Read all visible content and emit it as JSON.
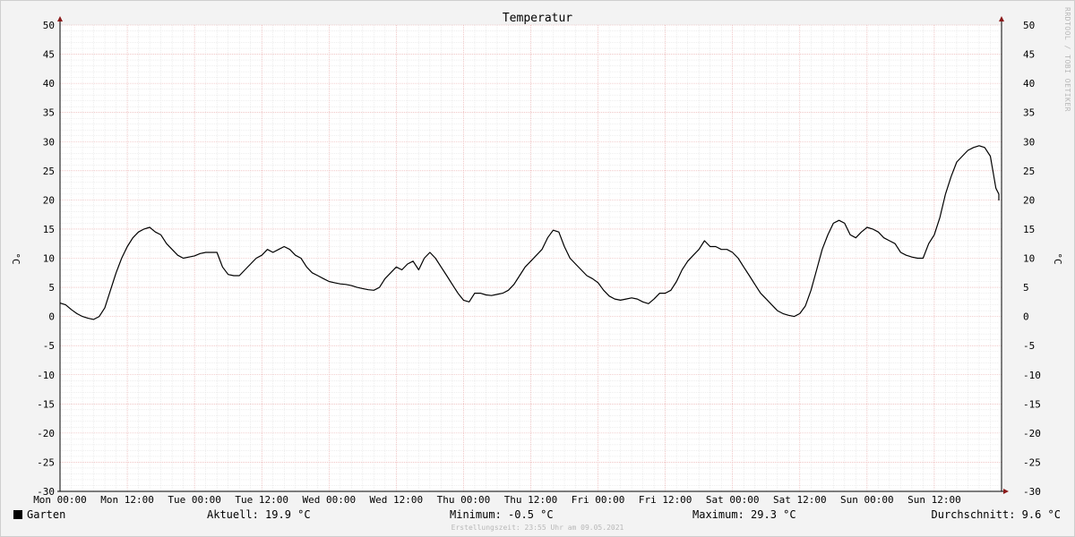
{
  "chart_data": {
    "type": "line",
    "title": "Temperatur",
    "ylabel_left": "°C",
    "ylabel_right": "°C",
    "ylim": [
      -30,
      50
    ],
    "y_ticks": [
      50,
      45,
      40,
      35,
      30,
      25,
      20,
      15,
      10,
      5,
      0,
      -5,
      -10,
      -15,
      -20,
      -25,
      -30
    ],
    "x_ticks": [
      "Mon 00:00",
      "Mon 12:00",
      "Tue 00:00",
      "Tue 12:00",
      "Wed 00:00",
      "Wed 12:00",
      "Thu 00:00",
      "Thu 12:00",
      "Fri 00:00",
      "Fri 12:00",
      "Sat 00:00",
      "Sat 12:00",
      "Sun 00:00",
      "Sun 12:00"
    ],
    "x_unit": "hours since Mon 00:00",
    "xlim": [
      0,
      168
    ],
    "grid": true,
    "series": [
      {
        "name": "Garten",
        "color": "#000000",
        "points": [
          [
            0,
            2.3
          ],
          [
            1,
            2.0
          ],
          [
            2,
            1.2
          ],
          [
            3,
            0.5
          ],
          [
            4,
            0.0
          ],
          [
            5,
            -0.3
          ],
          [
            6,
            -0.5
          ],
          [
            7,
            0.0
          ],
          [
            8,
            1.5
          ],
          [
            9,
            4.5
          ],
          [
            10,
            7.5
          ],
          [
            11,
            10.0
          ],
          [
            12,
            12.0
          ],
          [
            13,
            13.5
          ],
          [
            14,
            14.5
          ],
          [
            15,
            15.0
          ],
          [
            16,
            15.3
          ],
          [
            17,
            14.5
          ],
          [
            18,
            14.0
          ],
          [
            19,
            12.5
          ],
          [
            20,
            11.5
          ],
          [
            21,
            10.5
          ],
          [
            22,
            10.0
          ],
          [
            23,
            10.2
          ],
          [
            24,
            10.4
          ],
          [
            25,
            10.8
          ],
          [
            26,
            11.0
          ],
          [
            27,
            11.0
          ],
          [
            28,
            11.0
          ],
          [
            29,
            8.5
          ],
          [
            30,
            7.2
          ],
          [
            31,
            7.0
          ],
          [
            32,
            7.0
          ],
          [
            33,
            8.0
          ],
          [
            34,
            9.0
          ],
          [
            35,
            10.0
          ],
          [
            36,
            10.5
          ],
          [
            37,
            11.5
          ],
          [
            38,
            11.0
          ],
          [
            39,
            11.5
          ],
          [
            40,
            12.0
          ],
          [
            41,
            11.5
          ],
          [
            42,
            10.5
          ],
          [
            43,
            10.0
          ],
          [
            44,
            8.5
          ],
          [
            45,
            7.5
          ],
          [
            46,
            7.0
          ],
          [
            47,
            6.5
          ],
          [
            48,
            6.0
          ],
          [
            49,
            5.8
          ],
          [
            50,
            5.6
          ],
          [
            51,
            5.5
          ],
          [
            52,
            5.3
          ],
          [
            53,
            5.0
          ],
          [
            54,
            4.8
          ],
          [
            55,
            4.6
          ],
          [
            56,
            4.5
          ],
          [
            57,
            5.0
          ],
          [
            58,
            6.5
          ],
          [
            59,
            7.5
          ],
          [
            60,
            8.5
          ],
          [
            61,
            8.0
          ],
          [
            62,
            9.0
          ],
          [
            63,
            9.5
          ],
          [
            64,
            8.0
          ],
          [
            65,
            10.0
          ],
          [
            66,
            11.0
          ],
          [
            67,
            10.0
          ],
          [
            68,
            8.5
          ],
          [
            69,
            7.0
          ],
          [
            70,
            5.5
          ],
          [
            71,
            4.0
          ],
          [
            72,
            2.8
          ],
          [
            73,
            2.5
          ],
          [
            74,
            4.0
          ],
          [
            75,
            4.0
          ],
          [
            76,
            3.7
          ],
          [
            77,
            3.6
          ],
          [
            78,
            3.8
          ],
          [
            79,
            4.0
          ],
          [
            80,
            4.5
          ],
          [
            81,
            5.5
          ],
          [
            82,
            7.0
          ],
          [
            83,
            8.5
          ],
          [
            84,
            9.5
          ],
          [
            85,
            10.5
          ],
          [
            86,
            11.5
          ],
          [
            87,
            13.5
          ],
          [
            88,
            14.8
          ],
          [
            89,
            14.5
          ],
          [
            90,
            12.0
          ],
          [
            91,
            10.0
          ],
          [
            92,
            9.0
          ],
          [
            93,
            8.0
          ],
          [
            94,
            7.0
          ],
          [
            95,
            6.5
          ],
          [
            96,
            5.8
          ],
          [
            97,
            4.5
          ],
          [
            98,
            3.5
          ],
          [
            99,
            3.0
          ],
          [
            100,
            2.8
          ],
          [
            101,
            3.0
          ],
          [
            102,
            3.2
          ],
          [
            103,
            3.0
          ],
          [
            104,
            2.5
          ],
          [
            105,
            2.2
          ],
          [
            106,
            3.0
          ],
          [
            107,
            4.0
          ],
          [
            108,
            4.0
          ],
          [
            109,
            4.5
          ],
          [
            110,
            6.0
          ],
          [
            111,
            8.0
          ],
          [
            112,
            9.5
          ],
          [
            113,
            10.5
          ],
          [
            114,
            11.5
          ],
          [
            115,
            13.0
          ],
          [
            116,
            12.0
          ],
          [
            117,
            12.0
          ],
          [
            118,
            11.5
          ],
          [
            119,
            11.5
          ],
          [
            120,
            11.0
          ],
          [
            121,
            10.0
          ],
          [
            122,
            8.5
          ],
          [
            123,
            7.0
          ],
          [
            124,
            5.5
          ],
          [
            125,
            4.0
          ],
          [
            126,
            3.0
          ],
          [
            127,
            2.0
          ],
          [
            128,
            1.0
          ],
          [
            129,
            0.5
          ],
          [
            130,
            0.2
          ],
          [
            131,
            0.0
          ],
          [
            132,
            0.5
          ],
          [
            133,
            1.8
          ],
          [
            134,
            4.5
          ],
          [
            135,
            8.0
          ],
          [
            136,
            11.5
          ],
          [
            137,
            14.0
          ],
          [
            138,
            16.0
          ],
          [
            139,
            16.5
          ],
          [
            140,
            16.0
          ],
          [
            141,
            14.0
          ],
          [
            142,
            13.5
          ],
          [
            143,
            14.5
          ],
          [
            144,
            15.3
          ],
          [
            145,
            15.0
          ],
          [
            146,
            14.5
          ],
          [
            147,
            13.5
          ],
          [
            148,
            13.0
          ],
          [
            149,
            12.5
          ],
          [
            150,
            11.0
          ],
          [
            151,
            10.5
          ],
          [
            152,
            10.2
          ],
          [
            153,
            10.0
          ],
          [
            154,
            10.0
          ],
          [
            155,
            12.5
          ],
          [
            156,
            14.0
          ],
          [
            157,
            17.0
          ],
          [
            158,
            21.0
          ],
          [
            159,
            24.0
          ],
          [
            160,
            26.5
          ],
          [
            161,
            27.5
          ],
          [
            162,
            28.5
          ],
          [
            163,
            29.0
          ],
          [
            164,
            29.3
          ],
          [
            165,
            29.0
          ],
          [
            166,
            27.5
          ],
          [
            167,
            22.0
          ],
          [
            168,
            21.0
          ],
          [
            169,
            20.8
          ],
          [
            170,
            20.5
          ],
          [
            171,
            20.0
          ],
          [
            172,
            19.9
          ]
        ]
      }
    ]
  },
  "legend": {
    "name": "Garten",
    "aktuell": "Aktuell: 19.9 °C",
    "minimum": "Minimum: -0.5 °C",
    "maximum": "Maximum: 29.3 °C",
    "durchschnitt": "Durchschnitt: 9.6 °C"
  },
  "footer": "Erstellungszeit: 23:55 Uhr am 09.05.2021",
  "watermark": "RRDTOOL / TOBI OETIKER"
}
